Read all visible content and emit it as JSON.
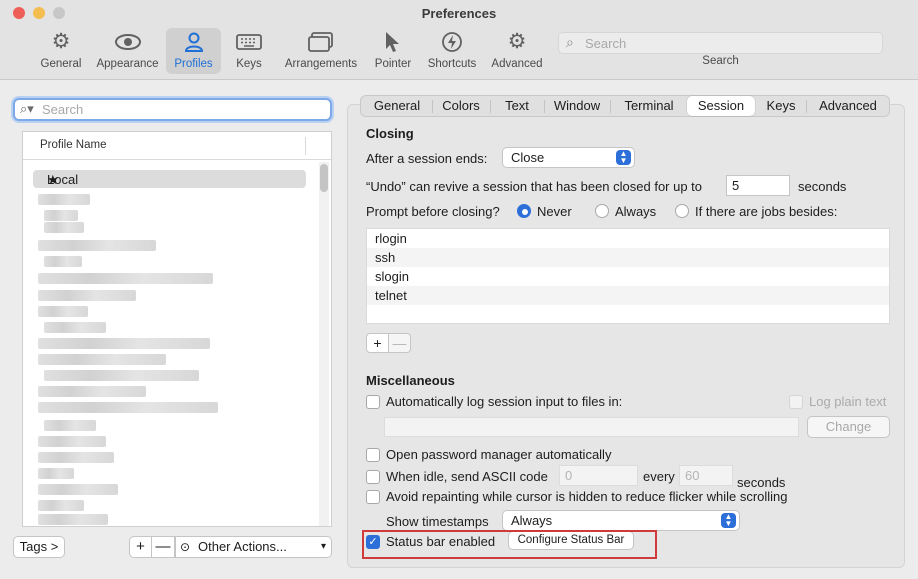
{
  "window": {
    "title": "Preferences"
  },
  "toolbar": {
    "items": [
      {
        "label": "General",
        "icon": "gear-icon"
      },
      {
        "label": "Appearance",
        "icon": "eye-icon"
      },
      {
        "label": "Profiles",
        "icon": "person-icon",
        "active": true
      },
      {
        "label": "Keys",
        "icon": "keyboard-icon"
      },
      {
        "label": "Arrangements",
        "icon": "windows-icon"
      },
      {
        "label": "Pointer",
        "icon": "pointer-icon"
      },
      {
        "label": "Shortcuts",
        "icon": "bolt-icon"
      },
      {
        "label": "Advanced",
        "icon": "gears-icon"
      }
    ],
    "search": {
      "placeholder": "Search",
      "label": "Search"
    }
  },
  "profiles": {
    "search_placeholder": "Search",
    "column_header": "Profile Name",
    "selected_profile": "Local",
    "tags_button": "Tags >",
    "add_button": "+",
    "remove_button": "—",
    "other_actions": "Other Actions..."
  },
  "tabs": [
    "General",
    "Colors",
    "Text",
    "Window",
    "Terminal",
    "Session",
    "Keys",
    "Advanced"
  ],
  "active_tab": "Session",
  "session": {
    "closing_header": "Closing",
    "after_session_ends_label": "After a session ends:",
    "after_session_ends_value": "Close",
    "undo_label": "“Undo” can revive a session that has been closed for up to",
    "undo_value": "5",
    "undo_unit": "seconds",
    "prompt_label": "Prompt before closing?",
    "prompt_options": [
      "Never",
      "Always",
      "If there are jobs besides:"
    ],
    "prompt_selected": "Never",
    "jobs": [
      "rlogin",
      "ssh",
      "slogin",
      "telnet"
    ],
    "jobs_add": "+",
    "jobs_remove": "—",
    "misc_header": "Miscellaneous",
    "auto_log_label": "Automatically log session input to files in:",
    "log_plain_text_label": "Log plain text",
    "change_button": "Change",
    "open_password_manager_label": "Open password manager automatically",
    "idle_label": "When idle, send ASCII code",
    "idle_code": "0",
    "idle_every": "every",
    "idle_seconds_value": "60",
    "idle_seconds_unit": "seconds",
    "avoid_repaint_label": "Avoid repainting while cursor is hidden to reduce flicker while scrolling",
    "show_timestamps_label": "Show timestamps",
    "show_timestamps_value": "Always",
    "status_bar_label": "Status bar enabled",
    "status_bar_checked": true,
    "configure_status_bar_button": "Configure Status Bar"
  },
  "colors": {
    "accent": "#2d6fd8",
    "highlight_border": "#d13a3a"
  }
}
